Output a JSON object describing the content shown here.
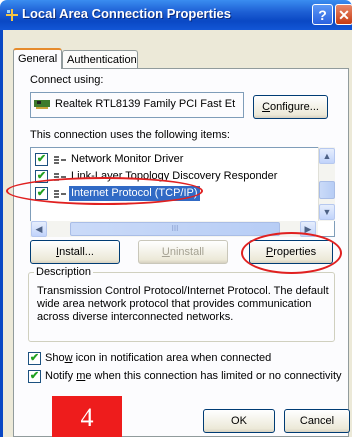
{
  "window": {
    "title": "Local Area Connection Properties",
    "help_label": "?",
    "close_label": "✕"
  },
  "tabs": [
    {
      "label": "General",
      "selected": true
    },
    {
      "label": "Authentication",
      "selected": false
    }
  ],
  "connect_using": {
    "label": "Connect using:",
    "adapter": "Realtek RTL8139 Family PCI Fast Et",
    "configure_button": "Configure..."
  },
  "items_label": "This connection uses the following items:",
  "items": [
    {
      "label": "Network Monitor Driver",
      "checked": true,
      "selected": false
    },
    {
      "label": "Link-Layer Topology Discovery Responder",
      "checked": true,
      "selected": false
    },
    {
      "label": "Internet Protocol (TCP/IP)",
      "checked": true,
      "selected": true
    }
  ],
  "scrollbar": {
    "up": "▲",
    "down": "▼",
    "left": "◀",
    "right": "▶",
    "grip": "III"
  },
  "buttons": {
    "install": "Install...",
    "uninstall": "Uninstall",
    "properties": "Properties"
  },
  "description": {
    "legend": "Description",
    "text": "Transmission Control Protocol/Internet Protocol. The default wide area network protocol that provides communication across diverse interconnected networks."
  },
  "options": [
    {
      "label": "Show icon in notification area when connected",
      "checked": true
    },
    {
      "label": "Notify me when this connection has limited or no connectivity",
      "checked": true
    }
  ],
  "footer": {
    "ok": "OK",
    "cancel": "Cancel"
  },
  "step_label": "4",
  "colors": {
    "titlebar": "#0a48c4",
    "selection": "#316ac5",
    "annotation": "#e02020"
  }
}
